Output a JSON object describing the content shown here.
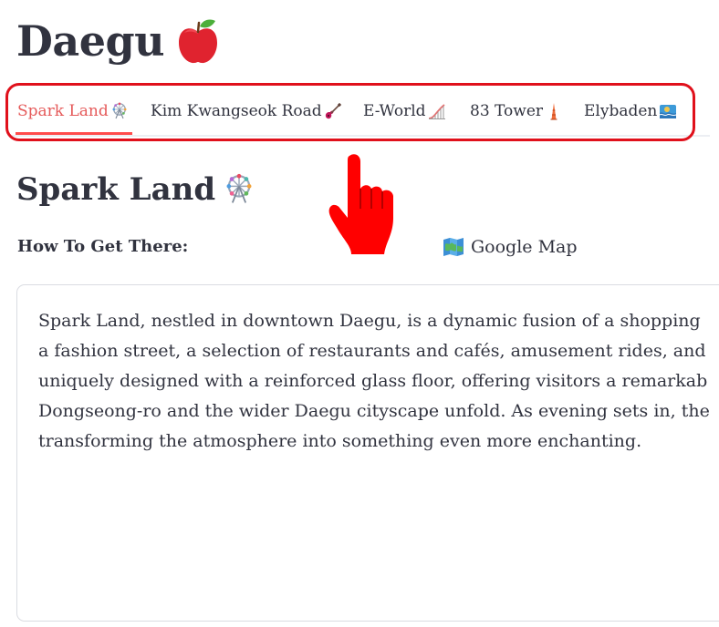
{
  "page": {
    "title": "Daegu",
    "title_icon": "apple-icon"
  },
  "tabs": [
    {
      "label": "Spark Land",
      "icon": "ferris-wheel-icon",
      "active": true
    },
    {
      "label": "Kim Kwangseok Road",
      "icon": "guitar-icon",
      "active": false
    },
    {
      "label": "E-World",
      "icon": "roller-coaster-icon",
      "active": false
    },
    {
      "label": "83 Tower",
      "icon": "tower-icon",
      "active": false
    },
    {
      "label": "Elybaden",
      "icon": "spa-icon",
      "active": false
    }
  ],
  "section": {
    "title": "Spark Land",
    "title_icon": "ferris-wheel-icon",
    "how_to_get_there": "How To Get There:",
    "map_link": "Google Map",
    "map_icon": "map-icon",
    "description_lines": [
      "Spark Land, nestled in downtown Daegu, is a dynamic fusion of a shopping",
      "a fashion street, a selection of restaurants and cafés, amusement rides, and",
      "uniquely designed with a reinforced glass floor, offering visitors a remarkab",
      "Dongseong-ro and the wider Daegu cityscape unfold. As evening sets in, the",
      "transforming the atmosphere into something even more enchanting."
    ]
  },
  "overlay": {
    "pointer_icon": "hand-pointer-icon"
  },
  "colors": {
    "text": "#31333f",
    "accent": "#ff4b4b",
    "active_tab_text": "#e55a5a",
    "highlight": "#e0101b",
    "border": "#dadce2"
  }
}
